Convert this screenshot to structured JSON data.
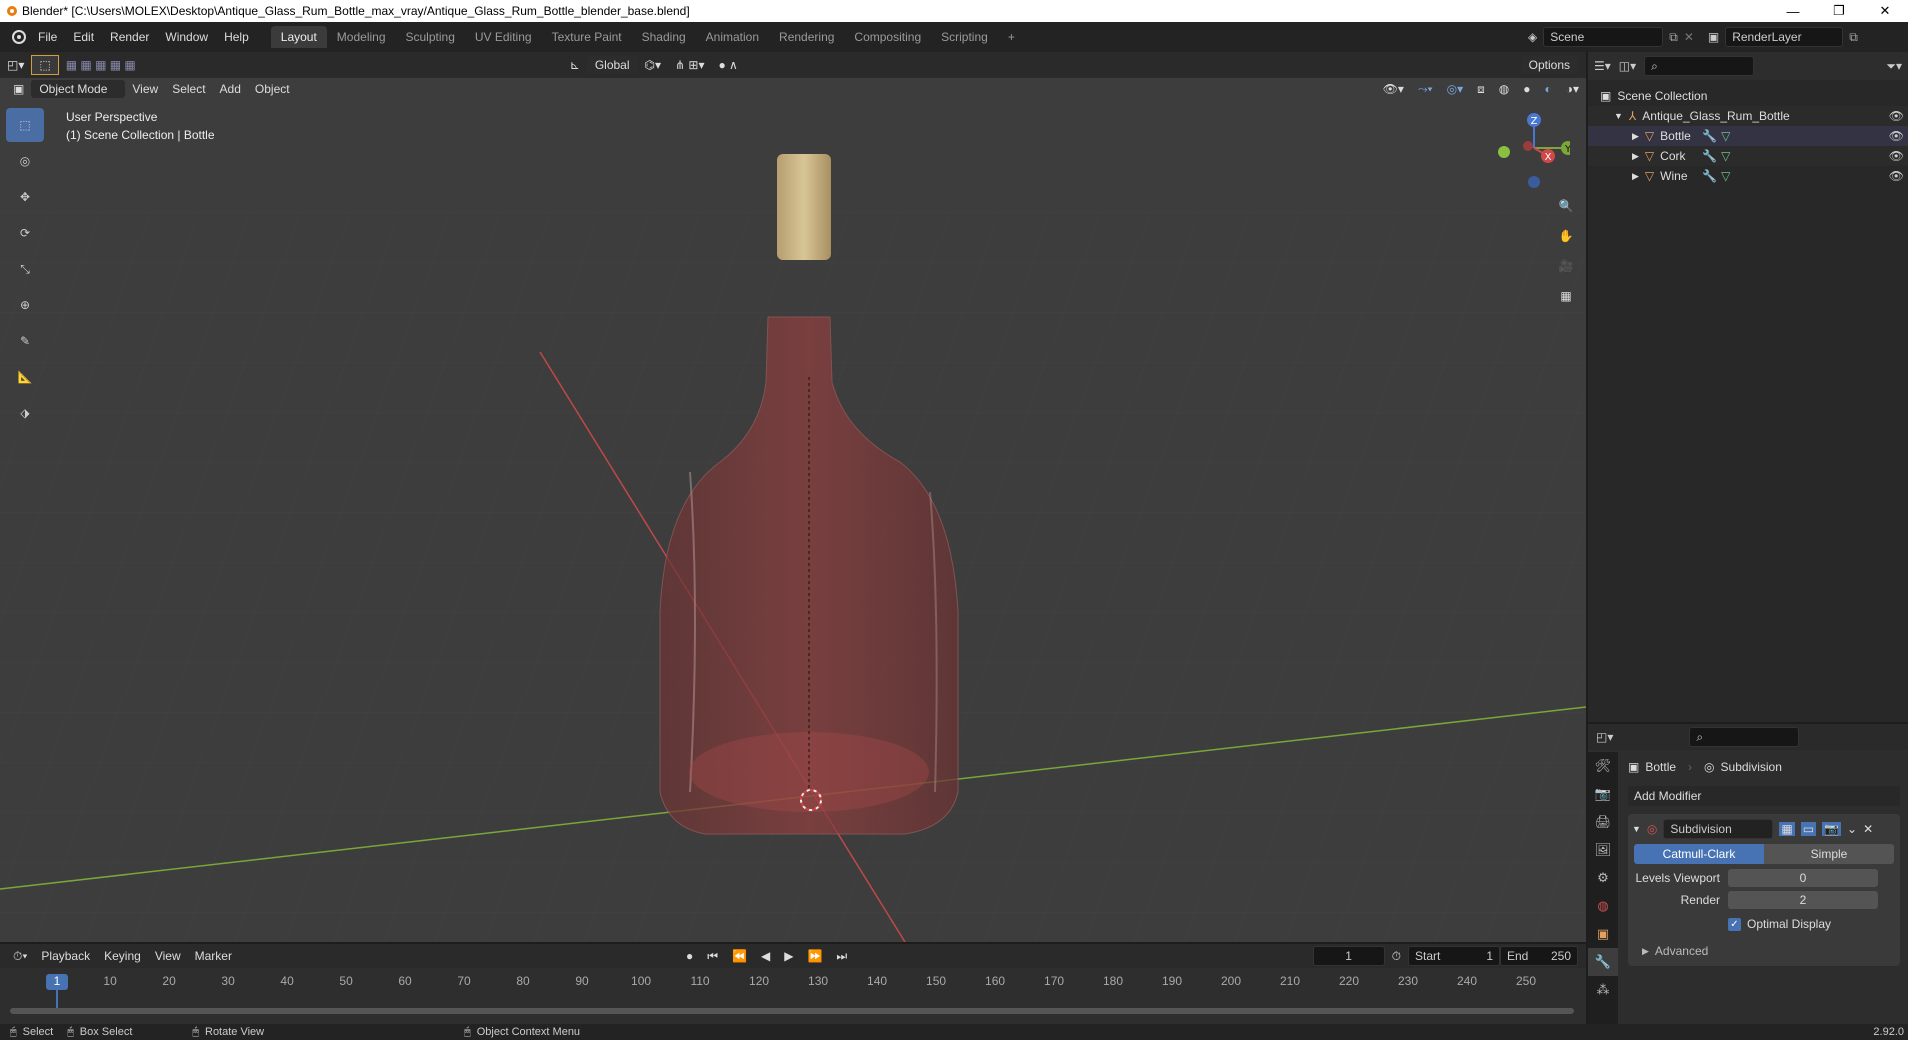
{
  "window": {
    "title": "Blender* [C:\\Users\\MOLEX\\Desktop\\Antique_Glass_Rum_Bottle_max_vray/Antique_Glass_Rum_Bottle_blender_base.blend]",
    "min_icon": "minimize-icon",
    "max_icon": "restore-icon",
    "close_icon": "close-icon"
  },
  "menu": [
    "File",
    "Edit",
    "Render",
    "Window",
    "Help"
  ],
  "workspaces": {
    "active": "Layout",
    "tabs": [
      "Layout",
      "Modeling",
      "Sculpting",
      "UV Editing",
      "Texture Paint",
      "Shading",
      "Animation",
      "Rendering",
      "Compositing",
      "Scripting"
    ],
    "add_icon": "plus-icon"
  },
  "scene": {
    "name": "Scene",
    "render_layer": "RenderLayer"
  },
  "viewport_header": {
    "transform_orientation": "Global",
    "options": "Options",
    "mode": "Object Mode",
    "menus": [
      "View",
      "Select",
      "Add",
      "Object"
    ]
  },
  "viewport": {
    "perspective": "User Perspective",
    "collection_line": "(1) Scene Collection | Bottle",
    "gizmo_axes": {
      "z": "Z",
      "y": "Y",
      "x": "X"
    },
    "colors": {
      "bg": "#3d3d3d",
      "grid": "#474747",
      "x_axis": "#c04848",
      "y_axis": "#7aa63a",
      "glass": "#8a3b3b",
      "cork": "#c7b48a"
    }
  },
  "outliner": {
    "root": "Scene Collection",
    "collection": "Antique_Glass_Rum_Bottle",
    "objects": [
      {
        "name": "Bottle"
      },
      {
        "name": "Cork"
      },
      {
        "name": "Wine"
      }
    ]
  },
  "properties": {
    "breadcrumb_object": "Bottle",
    "breadcrumb_modifier": "Subdivision",
    "add_modifier": "Add Modifier",
    "modifier": {
      "name": "Subdivision",
      "algo_active": "Catmull-Clark",
      "algo_other": "Simple",
      "levels_viewport_label": "Levels Viewport",
      "levels_viewport": "0",
      "render_label": "Render",
      "render": "2",
      "optimal_display": "Optimal Display",
      "optimal_display_checked": true,
      "advanced": "Advanced"
    },
    "accent": "#4772b3"
  },
  "timeline": {
    "menus": [
      "Playback",
      "Keying",
      "View",
      "Marker"
    ],
    "current_frame": "1",
    "start_label": "Start",
    "start": "1",
    "end_label": "End",
    "end": "250",
    "ticks": [
      "1",
      "10",
      "20",
      "30",
      "40",
      "50",
      "60",
      "70",
      "80",
      "90",
      "100",
      "110",
      "120",
      "130",
      "140",
      "150",
      "160",
      "170",
      "180",
      "190",
      "200",
      "210",
      "220",
      "230",
      "240",
      "250"
    ]
  },
  "statusbar": {
    "select": "Select",
    "box_select": "Box Select",
    "rotate_view": "Rotate View",
    "context_menu": "Object Context Menu",
    "version": "2.92.0"
  }
}
